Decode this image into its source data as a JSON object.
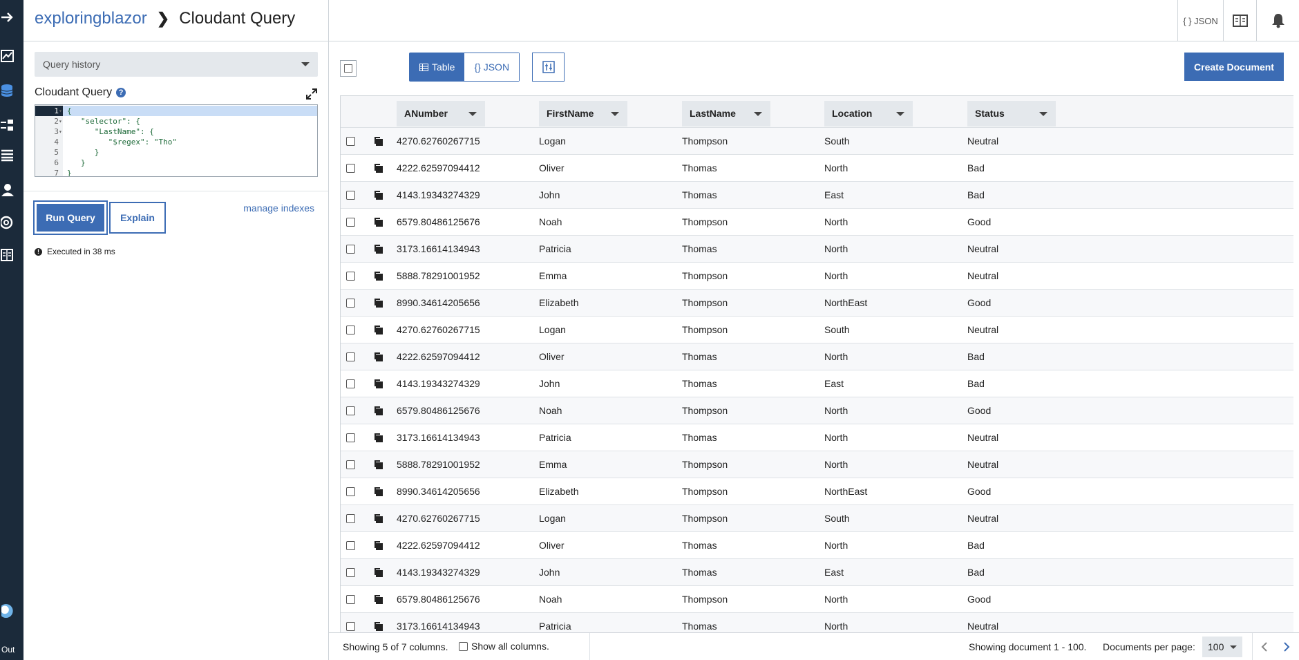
{
  "nav": {
    "icons": [
      "arrow-right-icon",
      "activity-chart-icon",
      "database-icon",
      "replication-icon",
      "list-icon",
      "user-icon",
      "support-icon",
      "documentation-icon",
      "user-avatar-icon"
    ],
    "logout_label": "Out"
  },
  "header": {
    "database": "exploringblazor",
    "page_title": "Cloudant Query",
    "json_label": "{ } JSON",
    "docs_icon": "book-icon",
    "notify_icon": "bell-icon"
  },
  "query_panel": {
    "history_label": "Query history",
    "editor_label": "Cloudant Query",
    "help": "?",
    "code_lines": [
      {
        "num": "1",
        "fold": "▾",
        "code": "{"
      },
      {
        "num": "2",
        "fold": "▾",
        "code": "   \"selector\": {"
      },
      {
        "num": "3",
        "fold": "▾",
        "code": "      \"LastName\": {"
      },
      {
        "num": "4",
        "fold": "",
        "code": "         \"$regex\": \"Tho\""
      },
      {
        "num": "5",
        "fold": "",
        "code": "      }"
      },
      {
        "num": "6",
        "fold": "",
        "code": "   }"
      },
      {
        "num": "7",
        "fold": "",
        "code": "}"
      }
    ],
    "run_label": "Run Query",
    "explain_label": "Explain",
    "manage_indexes": "manage indexes",
    "executed": "Executed in 38 ms"
  },
  "results": {
    "view_table": "Table",
    "view_json": "{} JSON",
    "create_label": "Create Document",
    "columns": [
      "ANumber",
      "FirstName",
      "LastName",
      "Location",
      "Status"
    ],
    "rows": [
      [
        "4270.62760267715",
        "Logan",
        "Thompson",
        "South",
        "Neutral"
      ],
      [
        "4222.62597094412",
        "Oliver",
        "Thomas",
        "North",
        "Bad"
      ],
      [
        "4143.19343274329",
        "John",
        "Thomas",
        "East",
        "Bad"
      ],
      [
        "6579.80486125676",
        "Noah",
        "Thompson",
        "North",
        "Good"
      ],
      [
        "3173.16614134943",
        "Patricia",
        "Thomas",
        "North",
        "Neutral"
      ],
      [
        "5888.78291001952",
        "Emma",
        "Thompson",
        "North",
        "Neutral"
      ],
      [
        "8990.34614205656",
        "Elizabeth",
        "Thompson",
        "NorthEast",
        "Good"
      ],
      [
        "4270.62760267715",
        "Logan",
        "Thompson",
        "South",
        "Neutral"
      ],
      [
        "4222.62597094412",
        "Oliver",
        "Thomas",
        "North",
        "Bad"
      ],
      [
        "4143.19343274329",
        "John",
        "Thomas",
        "East",
        "Bad"
      ],
      [
        "6579.80486125676",
        "Noah",
        "Thompson",
        "North",
        "Good"
      ],
      [
        "3173.16614134943",
        "Patricia",
        "Thomas",
        "North",
        "Neutral"
      ],
      [
        "5888.78291001952",
        "Emma",
        "Thompson",
        "North",
        "Neutral"
      ],
      [
        "8990.34614205656",
        "Elizabeth",
        "Thompson",
        "NorthEast",
        "Good"
      ],
      [
        "4270.62760267715",
        "Logan",
        "Thompson",
        "South",
        "Neutral"
      ],
      [
        "4222.62597094412",
        "Oliver",
        "Thomas",
        "North",
        "Bad"
      ],
      [
        "4143.19343274329",
        "John",
        "Thomas",
        "East",
        "Bad"
      ],
      [
        "6579.80486125676",
        "Noah",
        "Thompson",
        "North",
        "Good"
      ],
      [
        "3173.16614134943",
        "Patricia",
        "Thomas",
        "North",
        "Neutral"
      ]
    ],
    "footer": {
      "showing_columns": "Showing 5 of 7 columns.",
      "show_all": "Show all columns.",
      "showing_docs": "Showing document 1 - 100.",
      "per_page_label": "Documents per page:",
      "per_page_value": "100"
    }
  },
  "colors": {
    "accent": "#3c6cb4",
    "nav_bg": "#1b2a3a",
    "header_bg": "#e4e8ec"
  }
}
